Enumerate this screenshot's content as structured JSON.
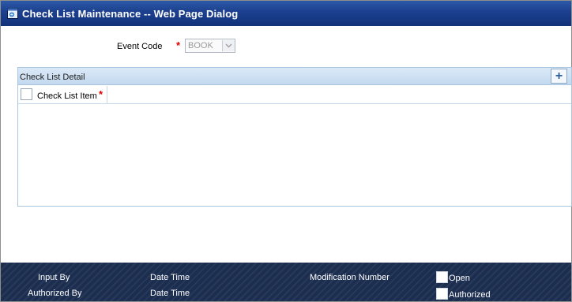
{
  "window": {
    "title": "Check List Maintenance -- Web Page Dialog"
  },
  "event": {
    "label": "Event Code",
    "required_mark": "*",
    "value": "BOOK"
  },
  "grid": {
    "title": "Check List Detail",
    "add_button": "+",
    "column_label": "Check List Item",
    "required_mark": "*"
  },
  "footer": {
    "input_by": "Input By",
    "date_time_1": "Date Time",
    "modification_number": "Modification Number",
    "open": "Open",
    "authorized_by": "Authorized By",
    "date_time_2": "Date Time",
    "authorized": "Authorized"
  },
  "colors": {
    "title_bar": "#1d4190",
    "footer": "#1c2e50",
    "required": "#e00000",
    "grid_header": "#c3d9ef"
  },
  "icons": [
    "window-app-icon",
    "dropdown-arrow-icon",
    "add-row-icon"
  ]
}
